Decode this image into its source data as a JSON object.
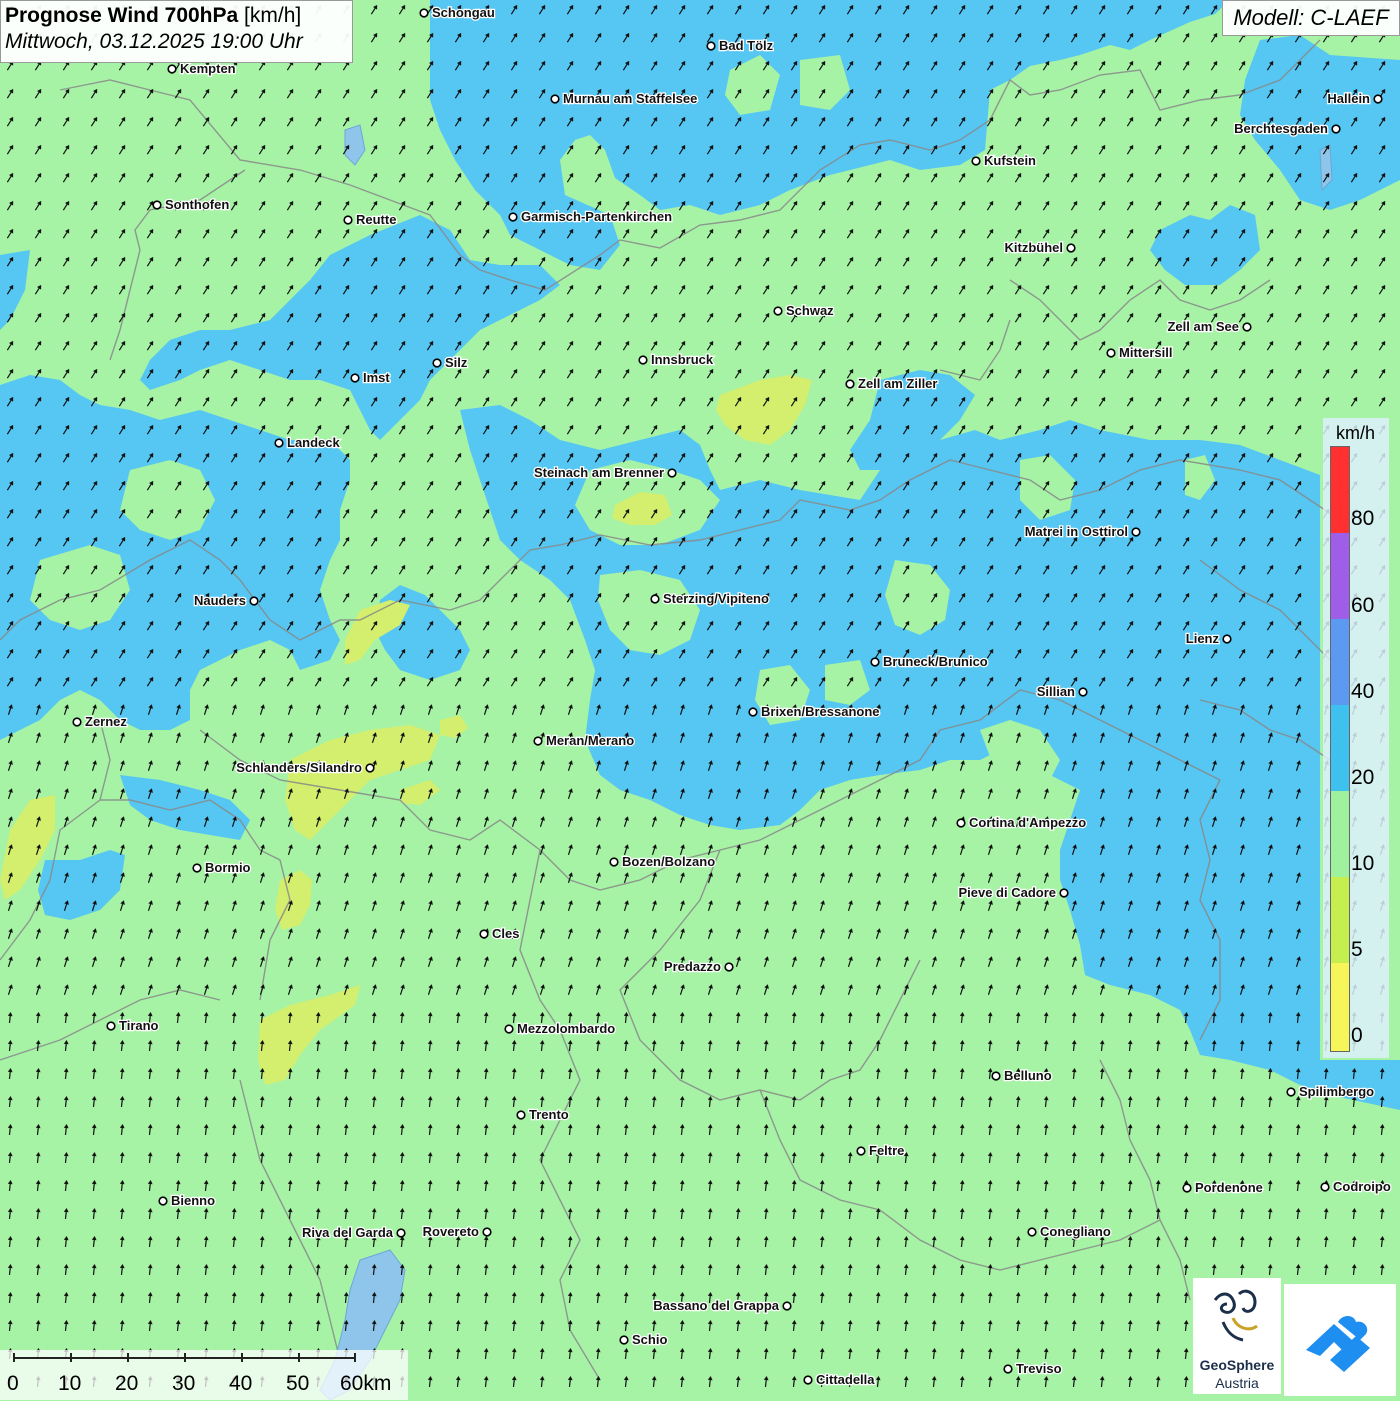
{
  "header": {
    "title_bold": "Prognose Wind 700hPa",
    "title_unit": "[km/h]",
    "datetime": "Mittwoch, 03.12.2025 19:00 Uhr",
    "model": "Modell: C-LAEF"
  },
  "legend": {
    "unit": "km/h",
    "ticks": [
      "80",
      "60",
      "40",
      "20",
      "10",
      "5",
      "0"
    ],
    "colors": [
      "#ff3030",
      "#9f5ee8",
      "#5b9af0",
      "#3fc1f0",
      "#9ef29e",
      "#c5ef4f",
      "#f6f55a"
    ]
  },
  "scale_bar": {
    "labels": [
      "0",
      "10",
      "20",
      "30",
      "40",
      "50",
      "60km"
    ]
  },
  "logos": {
    "geosphere_name": "GeoSphere",
    "geosphere_sub": "Austria",
    "brand_color": "#1e8ff0"
  },
  "cities": [
    {
      "name": "Schongau"
    },
    {
      "name": "Bad Tölz"
    },
    {
      "name": "Kempten"
    },
    {
      "name": "Murnau am Staffelsee"
    },
    {
      "name": "Hallein"
    },
    {
      "name": "Berchtesgaden"
    },
    {
      "name": "Kufstein"
    },
    {
      "name": "Sonthofen"
    },
    {
      "name": "Reutte"
    },
    {
      "name": "Garmisch-Partenkirchen"
    },
    {
      "name": "Kitzbühel"
    },
    {
      "name": "Schwaz"
    },
    {
      "name": "Zell am See"
    },
    {
      "name": "Mittersill"
    },
    {
      "name": "Imst"
    },
    {
      "name": "Silz"
    },
    {
      "name": "Innsbruck"
    },
    {
      "name": "Zell am Ziller"
    },
    {
      "name": "Landeck"
    },
    {
      "name": "Steinach am Brenner"
    },
    {
      "name": "Matrei in Osttirol"
    },
    {
      "name": "Nauders"
    },
    {
      "name": "Sterzing/Vipiteno"
    },
    {
      "name": "Lienz"
    },
    {
      "name": "Bruneck/Brunico"
    },
    {
      "name": "Sillian"
    },
    {
      "name": "Brixen/Bressanone"
    },
    {
      "name": "Zernez"
    },
    {
      "name": "Meran/Merano"
    },
    {
      "name": "Schlanders/Silandro"
    },
    {
      "name": "Cortina d'Ampezzo"
    },
    {
      "name": "Bozen/Bolzano"
    },
    {
      "name": "Bormio"
    },
    {
      "name": "Pieve di Cadore"
    },
    {
      "name": "Cles"
    },
    {
      "name": "Predazzo"
    },
    {
      "name": "Tirano"
    },
    {
      "name": "Mezzolombardo"
    },
    {
      "name": "Belluno"
    },
    {
      "name": "Spilimbergo"
    },
    {
      "name": "Trento"
    },
    {
      "name": "Feltre"
    },
    {
      "name": "Pordenone"
    },
    {
      "name": "Codroipo"
    },
    {
      "name": "Bienno"
    },
    {
      "name": "Riva del Garda"
    },
    {
      "name": "Rovereto"
    },
    {
      "name": "Conegliano"
    },
    {
      "name": "Bassano del Grappa"
    },
    {
      "name": "Schio"
    },
    {
      "name": "Treviso"
    },
    {
      "name": "Cittadella"
    }
  ]
}
